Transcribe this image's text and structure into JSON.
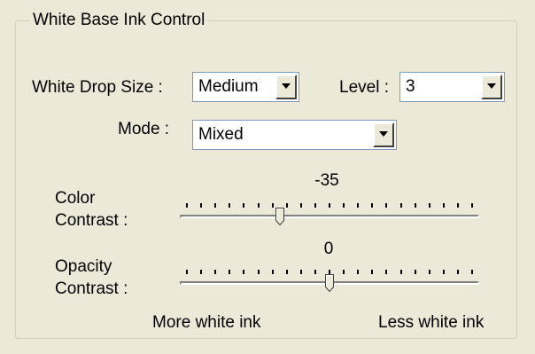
{
  "group": {
    "title": "White Base Ink Control"
  },
  "white_drop_size": {
    "label": "White Drop Size :",
    "value": "Medium"
  },
  "level": {
    "label": "Level :",
    "value": "3"
  },
  "mode": {
    "label": "Mode :",
    "value": "Mixed"
  },
  "color_contrast": {
    "label_line1": "Color",
    "label_line2": "Contrast :",
    "value": -35,
    "value_text": "-35",
    "min": -100,
    "max": 100,
    "tick_count": 21
  },
  "opacity_contrast": {
    "label_line1": "Opacity",
    "label_line2": "Contrast :",
    "value": 0,
    "value_text": "0",
    "min": -100,
    "max": 100,
    "tick_count": 21
  },
  "scale": {
    "left_label": "More white ink",
    "right_label": "Less white ink"
  }
}
